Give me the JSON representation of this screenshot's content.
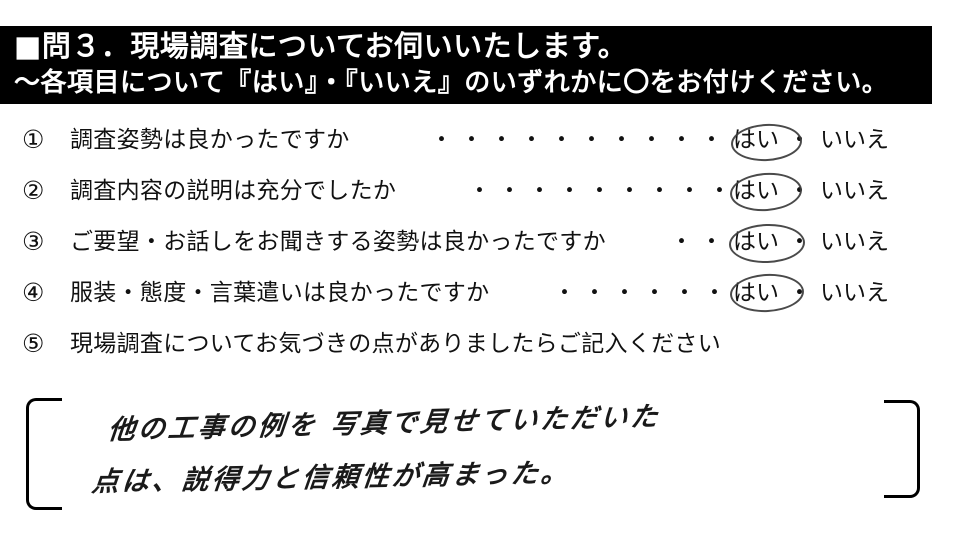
{
  "banner": {
    "line1": "■問３．現場調査についてお伺いいたします。",
    "line2": "〜各項目について『はい』・『いいえ』のいずれかに〇をお付けください。"
  },
  "questions": [
    {
      "number": "①",
      "text": "調査姿勢は良かったですか",
      "dots": "・・・・・・・・・・",
      "yes": "はい",
      "separator": "・",
      "no": "いいえ",
      "selected": "はい"
    },
    {
      "number": "②",
      "text": "調査内容の説明は充分でしたか",
      "dots": "・・・・・・・・・",
      "yes": "はい",
      "separator": "・",
      "no": "いいえ",
      "selected": "はい"
    },
    {
      "number": "③",
      "text": "ご要望・お話しをお聞きする姿勢は良かったですか",
      "dots": "・・",
      "yes": "はい",
      "separator": "・",
      "no": "いいえ",
      "selected": "はい"
    },
    {
      "number": "④",
      "text": "服装・態度・言葉遣いは良かったですか",
      "dots": "・・・・・・",
      "yes": "はい",
      "separator": "・",
      "no": "いいえ",
      "selected": "はい"
    },
    {
      "number": "⑤",
      "text": "現場調査についてお気づきの点がありましたらご記入ください",
      "dots": "",
      "yes": "",
      "separator": "",
      "no": "",
      "selected": ""
    }
  ],
  "handwritten_comment": {
    "line1": "他の工事の例を 写真で見せていただいた",
    "line2": "点は、説得力と信頼性が高まった。"
  },
  "colors": {
    "banner_background": "#000000",
    "banner_text": "#ffffff",
    "body_text": "#111111",
    "ink": "#1a1a1a",
    "page_background": "#ffffff"
  }
}
